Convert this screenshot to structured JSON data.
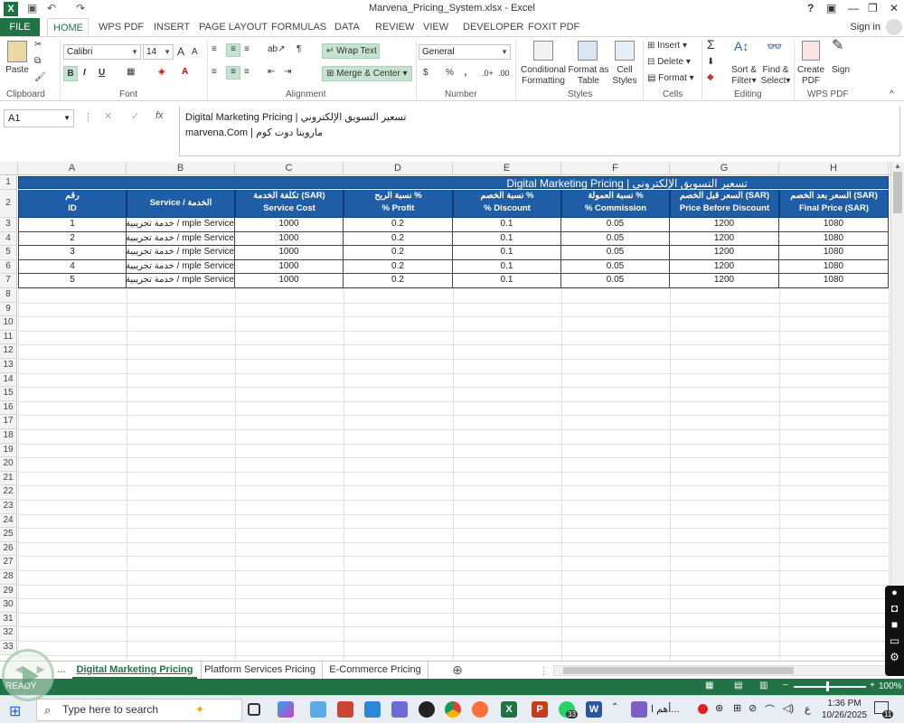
{
  "window": {
    "title": "Marvena_Pricing_System.xlsx - Excel",
    "help": "?",
    "signin": "Sign in"
  },
  "tabs": [
    "FILE",
    "HOME",
    "WPS PDF",
    "INSERT",
    "PAGE LAYOUT",
    "FORMULAS",
    "DATA",
    "REVIEW",
    "VIEW",
    "DEVELOPER",
    "FOXIT PDF"
  ],
  "ribbon": {
    "clipboard": {
      "paste": "Paste",
      "label": "Clipboard"
    },
    "font": {
      "name": "Calibri",
      "size": "14",
      "bold": "B",
      "italic": "I",
      "underline": "U",
      "label": "Font",
      "grow": "A",
      "shrink": "A"
    },
    "alignment": {
      "wrap": "Wrap Text",
      "merge": "Merge & Center",
      "label": "Alignment"
    },
    "number": {
      "format": "General",
      "currency": "$",
      "percent": "%",
      "comma": ",",
      "label": "Number"
    },
    "styles": {
      "conditional": "Conditional",
      "conditional2": "Formatting",
      "format_as": "Format as",
      "format_as2": "Table",
      "cell": "Cell",
      "cell2": "Styles",
      "label": "Styles"
    },
    "cells": {
      "insert": "Insert",
      "delete": "Delete",
      "format": "Format",
      "label": "Cells"
    },
    "editing": {
      "sum": "Σ",
      "sort": "Sort &",
      "sort2": "Filter",
      "find": "Find &",
      "find2": "Select",
      "label": "Editing"
    },
    "wps": {
      "create": "Create",
      "create2": "PDF",
      "sign": "Sign",
      "label": "WPS PDF"
    }
  },
  "formula_bar": {
    "name_box": "A1",
    "fx": "fx",
    "line1": "Digital Marketing Pricing | تسعير التسويق الإلكتروني",
    "line2": "marvena.Com | ماروينا دوت كوم"
  },
  "columns": [
    "A",
    "B",
    "C",
    "D",
    "E",
    "F",
    "G",
    "H"
  ],
  "rows": [
    "1",
    "2",
    "3",
    "4",
    "5",
    "6",
    "7",
    "8",
    "9",
    "10",
    "11",
    "12",
    "13",
    "14",
    "15",
    "16",
    "17",
    "18",
    "19",
    "20",
    "21",
    "22",
    "23",
    "24",
    "25",
    "26",
    "27",
    "28",
    "29",
    "30",
    "31",
    "32",
    "33"
  ],
  "sheet": {
    "title": "Digital Marketing Pricing | تسعير التسويق الإلكتروني",
    "headers": [
      {
        "ar": "رقم",
        "en": "ID"
      },
      {
        "ar": "Service / الخدمة",
        "en": ""
      },
      {
        "ar": "تكلفة الخدمة (SAR)",
        "en": "Service Cost"
      },
      {
        "ar": "نسبة الربح %",
        "en": "% Profit"
      },
      {
        "ar": "نسبة الخصم %",
        "en": "% Discount"
      },
      {
        "ar": "نسبة العمولة %",
        "en": "% Commission"
      },
      {
        "ar": "السعر قبل الخصم (SAR)",
        "en": "Price Before Discount"
      },
      {
        "ar": "السعر بعد الخصم (SAR)",
        "en": "Final Price (SAR)"
      }
    ],
    "data": [
      [
        "1",
        "mple Service / خدمة تجريبية",
        "1000",
        "0.2",
        "0.1",
        "0.05",
        "1200",
        "1080"
      ],
      [
        "2",
        "mple Service / خدمة تجريبية",
        "1000",
        "0.2",
        "0.1",
        "0.05",
        "1200",
        "1080"
      ],
      [
        "3",
        "mple Service / خدمة تجريبية",
        "1000",
        "0.2",
        "0.1",
        "0.05",
        "1200",
        "1080"
      ],
      [
        "4",
        "mple Service / خدمة تجريبية",
        "1000",
        "0.2",
        "0.1",
        "0.05",
        "1200",
        "1080"
      ],
      [
        "5",
        "mple Service / خدمة تجريبية",
        "1000",
        "0.2",
        "0.1",
        "0.05",
        "1200",
        "1080"
      ]
    ]
  },
  "sheet_tabs": {
    "more": "...",
    "items": [
      "Digital Marketing Pricing",
      "Platform Services Pricing",
      "E-Commerce Pricing"
    ],
    "add": "⊕"
  },
  "status": {
    "ready": "READY",
    "zoom": "100%",
    "zoom_minus": "−",
    "zoom_plus": "+"
  },
  "taskbar": {
    "search_placeholder": "Type here to search",
    "teams_badge": "33",
    "app_label": "أهم ا...",
    "lang": "ع",
    "time": "1:36 PM",
    "date": "10/26/2025",
    "notif": "11"
  },
  "colors": {
    "excel_green": "#217346",
    "header_blue": "#1f5da6"
  }
}
